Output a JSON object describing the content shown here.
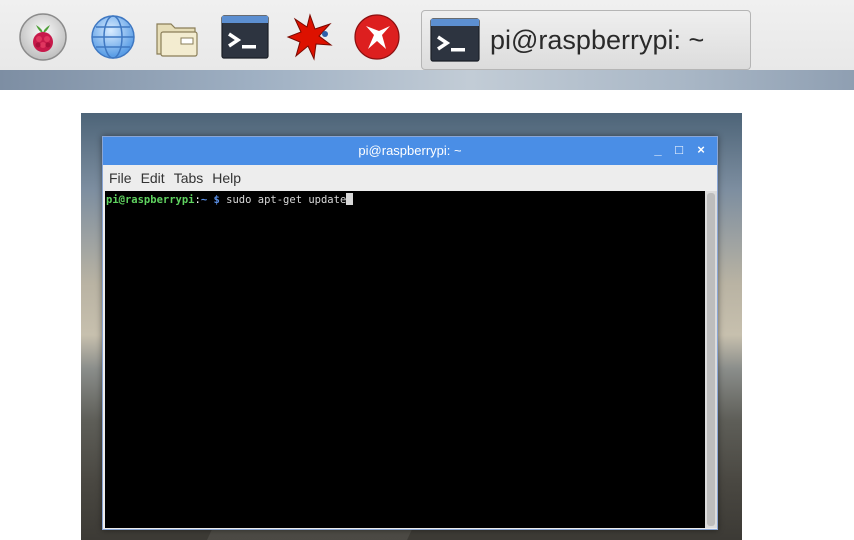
{
  "taskbar": {
    "icons": [
      {
        "name": "raspberry-menu-icon"
      },
      {
        "name": "web-browser-icon"
      },
      {
        "name": "file-manager-icon"
      },
      {
        "name": "terminal-icon"
      },
      {
        "name": "mathematica-icon"
      },
      {
        "name": "wolfram-icon"
      }
    ],
    "task_button_label": "pi@raspberrypi: ~"
  },
  "window": {
    "title": "pi@raspberrypi: ~",
    "minimize": "_",
    "maximize": "□",
    "close": "×",
    "menu": [
      "File",
      "Edit",
      "Tabs",
      "Help"
    ]
  },
  "terminal": {
    "user_host": "pi@raspberrypi",
    "colon": ":",
    "path": "~",
    "dollar": "$",
    "command": "sudo apt-get update"
  },
  "colors": {
    "titlebar": "#4a8ee6",
    "prompt_user": "#5fd25f",
    "prompt_path": "#5a8fe6",
    "terminal_bg": "#000000"
  }
}
